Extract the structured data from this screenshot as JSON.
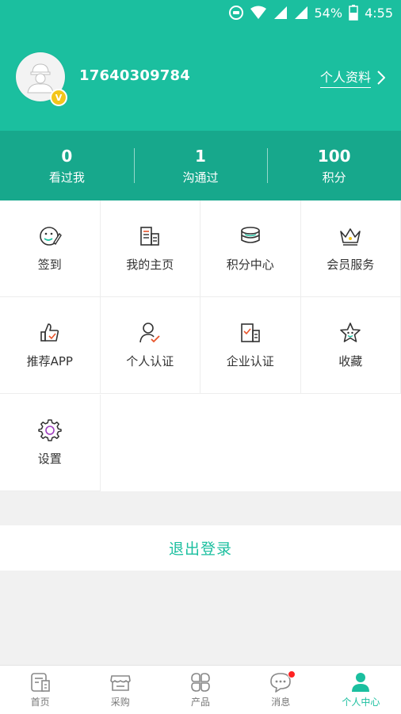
{
  "statusbar": {
    "battery": "54%",
    "time": "4:55"
  },
  "user": {
    "phone": "17640309784",
    "badge": "V",
    "profile_link": "个人资料"
  },
  "stats": [
    {
      "num": "0",
      "label": "看过我"
    },
    {
      "num": "1",
      "label": "沟通过"
    },
    {
      "num": "100",
      "label": "积分"
    }
  ],
  "menu": [
    {
      "label": "签到",
      "icon": "sign-in-icon"
    },
    {
      "label": "我的主页",
      "icon": "homepage-icon"
    },
    {
      "label": "积分中心",
      "icon": "coins-icon"
    },
    {
      "label": "会员服务",
      "icon": "crown-icon"
    },
    {
      "label": "推荐APP",
      "icon": "thumbs-up-icon"
    },
    {
      "label": "个人认证",
      "icon": "person-check-icon"
    },
    {
      "label": "企业认证",
      "icon": "building-check-icon"
    },
    {
      "label": "收藏",
      "icon": "star-icon"
    },
    {
      "label": "设置",
      "icon": "gear-icon"
    }
  ],
  "logout": "退出登录",
  "tabs": [
    {
      "label": "首页",
      "icon": "home-icon",
      "active": false
    },
    {
      "label": "采购",
      "icon": "shop-icon",
      "active": false
    },
    {
      "label": "产品",
      "icon": "grid-icon",
      "active": false
    },
    {
      "label": "消息",
      "icon": "chat-icon",
      "active": false
    },
    {
      "label": "个人中心",
      "icon": "person-icon",
      "active": true
    }
  ],
  "colors": {
    "primary": "#1bbf9f",
    "primary_dark": "#17a88c",
    "badge": "#f3c51b",
    "alert": "#ff2222"
  }
}
